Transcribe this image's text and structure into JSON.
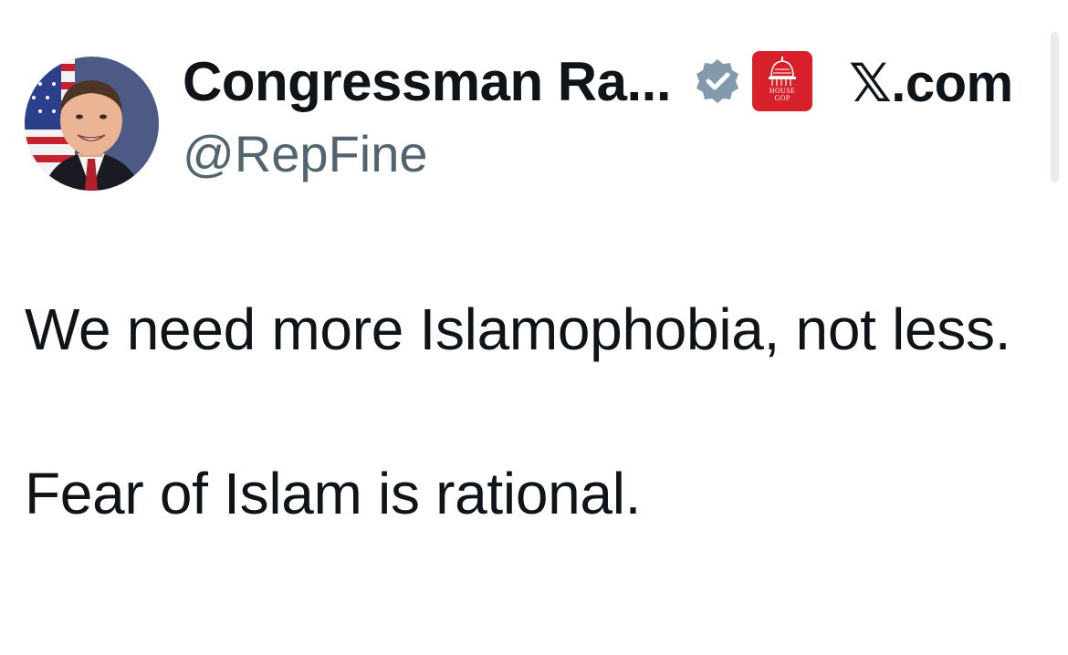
{
  "author": {
    "display_name": "Congressman Ra...",
    "handle": "@RepFine",
    "avatar_icon": "portrait-photo",
    "verified_icon": "verified-badge-icon",
    "verified_color": "#829aab",
    "affiliate": {
      "icon": "capitol-dome-icon",
      "lines": [
        "HOUSE",
        "GOP"
      ],
      "color": "#d8202b"
    }
  },
  "site": {
    "label": "𝕏.com"
  },
  "tweet": {
    "paragraphs": [
      "We need more Islamophobia, not less.",
      "Fear of Islam is rational."
    ]
  },
  "colors": {
    "text": "#0f1419",
    "secondary": "#536471",
    "background": "#ffffff"
  }
}
